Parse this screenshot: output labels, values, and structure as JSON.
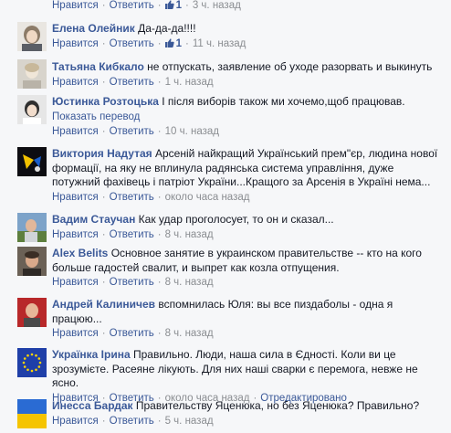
{
  "labels": {
    "like": "Нравится",
    "reply": "Ответить",
    "show_translation": "Показать перевод",
    "edited": "Отредактировано",
    "sep": "·"
  },
  "comments": [
    {
      "name": "",
      "text": "",
      "likes": "1",
      "time": "3 ч. назад",
      "avatar": "partial"
    },
    {
      "name": "Елена Олейник",
      "text": "Да-да-да!!!!",
      "likes": "1",
      "time": "11 ч. назад",
      "avatar": "woman-portrait"
    },
    {
      "name": "Татьяна Кибкало",
      "text": "не отпускать, заявление об уходе разорвать и выкинуть",
      "time": "1 ч. назад",
      "avatar": "light-portrait"
    },
    {
      "name": "Юстинка Розтоцька",
      "text": "І після виборів також ми хочемо,щоб працював.",
      "translate": "Показать перевод",
      "time": "10 ч. назад",
      "avatar": "photo-portrait"
    },
    {
      "name": "Виктория Надутая",
      "text": "Арсеній найкращий Український прем\"єр, людина нової формації, на яку не вплинула радянська система управління, дуже потужний фахівець і патріот України...Кращого за Арсенія в Україні нема...",
      "time": "около часа назад",
      "avatar": "dark-logo"
    },
    {
      "name": "Вадим Стаучан",
      "text": "Как удар проголосует, то он и сказал...",
      "time": "8 ч. назад",
      "avatar": "man-outdoor"
    },
    {
      "name": "Alex Belits",
      "text": "Основное занятие в украинском правительстве -- кто на кого больше гадостей свалит, и выпрет как козла отпущения.",
      "time": "8 ч. назад",
      "avatar": "man-dark"
    },
    {
      "name": "Андрей Калиничев",
      "text": "вспомнилась Юля: вы все пиздаболы - одна я працюю...",
      "time": "8 ч. назад",
      "avatar": "man-red"
    },
    {
      "name": "Українка Ірина",
      "text": "Правильно. Люди, наша сила в Єдності. Коли ви це зрозумієте. Расеяне лікують. Для них наші сварки є перемога, невже не ясно.",
      "time": "около часа назад",
      "edited": "Отредактировано",
      "avatar": "eu-flag"
    },
    {
      "name": "Инесса Бардак",
      "text": "Правительству Яценюка, но без Яценюка? Правильно?",
      "time": "5 ч. назад",
      "avatar": "ua-flag"
    }
  ],
  "colors": {
    "link": "#3b5998",
    "meta": "#8a8d91",
    "text": "#141823",
    "background": "#f6f7f9"
  }
}
